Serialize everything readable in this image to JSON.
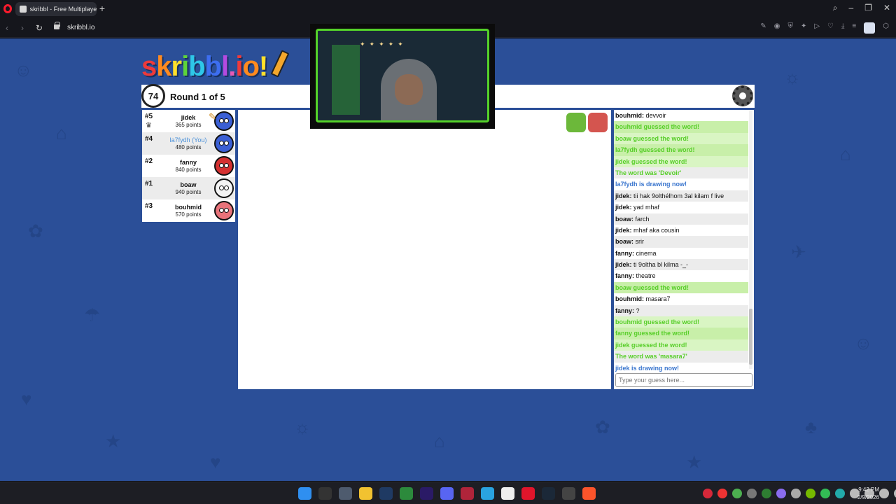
{
  "browser": {
    "tab_title": "skribbl - Free Multiplayer",
    "url": "skribbl.io"
  },
  "game": {
    "logo": "skribbl.io",
    "timer": "74",
    "round_text": "Round 1 of 5"
  },
  "players": [
    {
      "rank": "#5",
      "name": "jidek",
      "points": "365 points",
      "you": false,
      "avatar_color": "#3b5fd4",
      "drawing": true,
      "crown": true
    },
    {
      "rank": "#4",
      "name": "la7fydh (You)",
      "points": "480 points",
      "you": true,
      "avatar_color": "#3b5fd4",
      "drawing": false,
      "crown": false
    },
    {
      "rank": "#2",
      "name": "fanny",
      "points": "840 points",
      "you": false,
      "avatar_color": "#d43030",
      "drawing": false,
      "crown": false
    },
    {
      "rank": "#1",
      "name": "boaw",
      "points": "940 points",
      "you": false,
      "avatar_color": "#f4f4f4",
      "drawing": false,
      "crown": false
    },
    {
      "rank": "#3",
      "name": "bouhmid",
      "points": "570 points",
      "you": false,
      "avatar_color": "#e8737a",
      "drawing": false,
      "crown": false
    }
  ],
  "chat": {
    "messages": [
      {
        "type": "msg",
        "user": "bouhmid:",
        "text": " devvoir"
      },
      {
        "type": "guessed",
        "text": "bouhmid guessed the word!"
      },
      {
        "type": "guessed",
        "text": "boaw guessed the word!"
      },
      {
        "type": "guessed",
        "text": "la7fydh guessed the word!"
      },
      {
        "type": "guessed",
        "text": "jidek guessed the word!"
      },
      {
        "type": "info",
        "text": "The word was 'Devoir'"
      },
      {
        "type": "drawing",
        "text": "la7fydh is drawing now!"
      },
      {
        "type": "msg",
        "user": "jidek:",
        "text": " tii hak 9olthélhom 3al kilam f live"
      },
      {
        "type": "msg",
        "user": "jidek:",
        "text": " yad mhaf"
      },
      {
        "type": "msg",
        "user": "boaw:",
        "text": " farch"
      },
      {
        "type": "msg",
        "user": "jidek:",
        "text": " mhaf aka cousin"
      },
      {
        "type": "msg",
        "user": "boaw:",
        "text": " srir"
      },
      {
        "type": "msg",
        "user": "fanny:",
        "text": " cinema"
      },
      {
        "type": "msg",
        "user": "jidek:",
        "text": " ti 9oltha bl kilma -_-"
      },
      {
        "type": "msg",
        "user": "fanny:",
        "text": " theatre"
      },
      {
        "type": "guessed",
        "text": "boaw guessed the word!"
      },
      {
        "type": "msg",
        "user": "bouhmid:",
        "text": " masara7"
      },
      {
        "type": "msg",
        "user": "fanny:",
        "text": " ?"
      },
      {
        "type": "guessed",
        "text": "bouhmid guessed the word!"
      },
      {
        "type": "guessed",
        "text": "fanny guessed the word!"
      },
      {
        "type": "guessed",
        "text": "jidek guessed the word!"
      },
      {
        "type": "info",
        "text": "The word was 'masara7'"
      },
      {
        "type": "drawing",
        "text": "jidek is drawing now!"
      }
    ],
    "input_placeholder": "Type your guess here..."
  },
  "taskbar": {
    "time": "9:42 PM",
    "date": "2/9/2026"
  },
  "colors": {
    "page_bg": "#2b4f98",
    "guessed": "#56ce27",
    "drawing": "#3975ce",
    "webcam_frame": "#55d32a"
  }
}
